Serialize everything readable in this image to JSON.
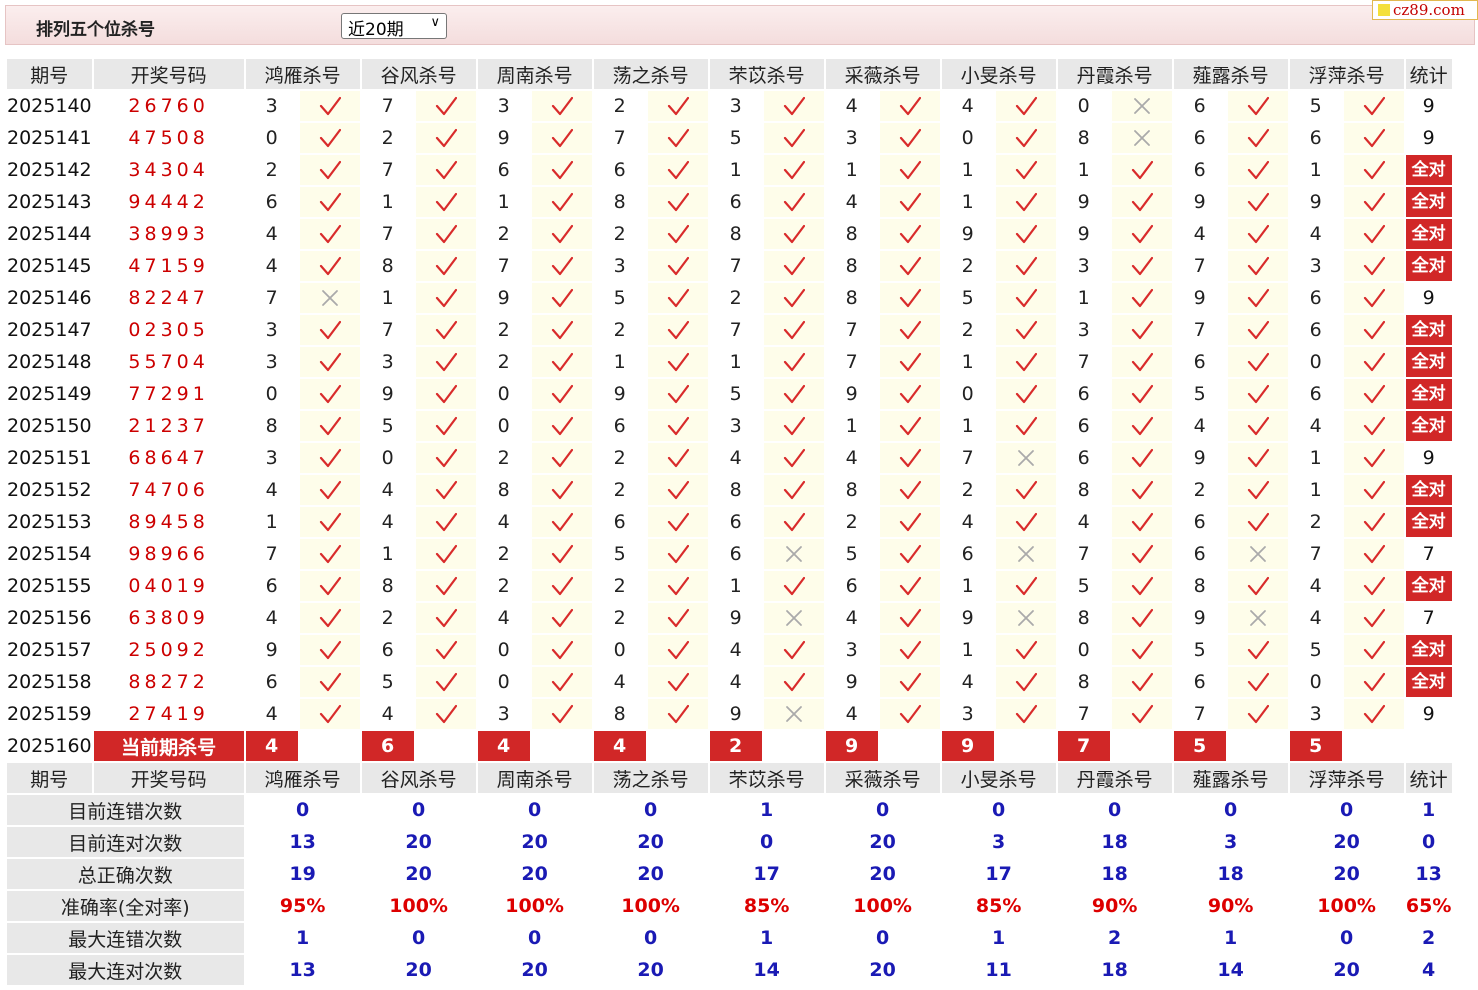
{
  "header": {
    "title": "排列五个位杀号",
    "period_select": {
      "selected": "近20期"
    },
    "logo": "cz89.com"
  },
  "table": {
    "col_period": "期号",
    "col_draw": "开奖号码",
    "col_stat": "统计",
    "experts": [
      "鸿雁杀号",
      "谷风杀号",
      "周南杀号",
      "荡之杀号",
      "芣苡杀号",
      "采薇杀号",
      "小旻杀号",
      "丹霞杀号",
      "薤露杀号",
      "浮萍杀号"
    ],
    "rows": [
      {
        "period": "2025140",
        "draw": "26760",
        "kills": [
          3,
          7,
          3,
          2,
          3,
          4,
          4,
          0,
          6,
          5
        ],
        "hits": [
          1,
          1,
          1,
          1,
          1,
          1,
          1,
          0,
          1,
          1
        ],
        "stat": "9"
      },
      {
        "period": "2025141",
        "draw": "47508",
        "kills": [
          0,
          2,
          9,
          7,
          5,
          3,
          0,
          8,
          6,
          6
        ],
        "hits": [
          1,
          1,
          1,
          1,
          1,
          1,
          1,
          0,
          1,
          1
        ],
        "stat": "9"
      },
      {
        "period": "2025142",
        "draw": "34304",
        "kills": [
          2,
          7,
          6,
          6,
          1,
          1,
          1,
          1,
          6,
          1
        ],
        "hits": [
          1,
          1,
          1,
          1,
          1,
          1,
          1,
          1,
          1,
          1
        ],
        "stat": "全对"
      },
      {
        "period": "2025143",
        "draw": "94442",
        "kills": [
          6,
          1,
          1,
          8,
          6,
          4,
          1,
          9,
          9,
          9
        ],
        "hits": [
          1,
          1,
          1,
          1,
          1,
          1,
          1,
          1,
          1,
          1
        ],
        "stat": "全对"
      },
      {
        "period": "2025144",
        "draw": "38993",
        "kills": [
          4,
          7,
          2,
          2,
          8,
          8,
          9,
          9,
          4,
          4
        ],
        "hits": [
          1,
          1,
          1,
          1,
          1,
          1,
          1,
          1,
          1,
          1
        ],
        "stat": "全对"
      },
      {
        "period": "2025145",
        "draw": "47159",
        "kills": [
          4,
          8,
          7,
          3,
          7,
          8,
          2,
          3,
          7,
          3
        ],
        "hits": [
          1,
          1,
          1,
          1,
          1,
          1,
          1,
          1,
          1,
          1
        ],
        "stat": "全对"
      },
      {
        "period": "2025146",
        "draw": "82247",
        "kills": [
          7,
          1,
          9,
          5,
          2,
          8,
          5,
          1,
          9,
          6
        ],
        "hits": [
          0,
          1,
          1,
          1,
          1,
          1,
          1,
          1,
          1,
          1
        ],
        "stat": "9"
      },
      {
        "period": "2025147",
        "draw": "02305",
        "kills": [
          3,
          7,
          2,
          2,
          7,
          7,
          2,
          3,
          7,
          6
        ],
        "hits": [
          1,
          1,
          1,
          1,
          1,
          1,
          1,
          1,
          1,
          1
        ],
        "stat": "全对"
      },
      {
        "period": "2025148",
        "draw": "55704",
        "kills": [
          3,
          3,
          2,
          1,
          1,
          7,
          1,
          7,
          6,
          0
        ],
        "hits": [
          1,
          1,
          1,
          1,
          1,
          1,
          1,
          1,
          1,
          1
        ],
        "stat": "全对"
      },
      {
        "period": "2025149",
        "draw": "77291",
        "kills": [
          0,
          9,
          0,
          9,
          5,
          9,
          0,
          6,
          5,
          6
        ],
        "hits": [
          1,
          1,
          1,
          1,
          1,
          1,
          1,
          1,
          1,
          1
        ],
        "stat": "全对"
      },
      {
        "period": "2025150",
        "draw": "21237",
        "kills": [
          8,
          5,
          0,
          6,
          3,
          1,
          1,
          6,
          4,
          4
        ],
        "hits": [
          1,
          1,
          1,
          1,
          1,
          1,
          1,
          1,
          1,
          1
        ],
        "stat": "全对"
      },
      {
        "period": "2025151",
        "draw": "68647",
        "kills": [
          3,
          0,
          2,
          2,
          4,
          4,
          7,
          6,
          9,
          1
        ],
        "hits": [
          1,
          1,
          1,
          1,
          1,
          1,
          0,
          1,
          1,
          1
        ],
        "stat": "9"
      },
      {
        "period": "2025152",
        "draw": "74706",
        "kills": [
          4,
          4,
          8,
          2,
          8,
          8,
          2,
          8,
          2,
          1
        ],
        "hits": [
          1,
          1,
          1,
          1,
          1,
          1,
          1,
          1,
          1,
          1
        ],
        "stat": "全对"
      },
      {
        "period": "2025153",
        "draw": "89458",
        "kills": [
          1,
          4,
          4,
          6,
          6,
          2,
          4,
          4,
          6,
          2
        ],
        "hits": [
          1,
          1,
          1,
          1,
          1,
          1,
          1,
          1,
          1,
          1
        ],
        "stat": "全对"
      },
      {
        "period": "2025154",
        "draw": "98966",
        "kills": [
          7,
          1,
          2,
          5,
          6,
          5,
          6,
          7,
          6,
          7
        ],
        "hits": [
          1,
          1,
          1,
          1,
          0,
          1,
          0,
          1,
          0,
          1
        ],
        "stat": "7"
      },
      {
        "period": "2025155",
        "draw": "04019",
        "kills": [
          6,
          8,
          2,
          2,
          1,
          6,
          1,
          5,
          8,
          4
        ],
        "hits": [
          1,
          1,
          1,
          1,
          1,
          1,
          1,
          1,
          1,
          1
        ],
        "stat": "全对"
      },
      {
        "period": "2025156",
        "draw": "63809",
        "kills": [
          4,
          2,
          4,
          2,
          9,
          4,
          9,
          8,
          9,
          4
        ],
        "hits": [
          1,
          1,
          1,
          1,
          0,
          1,
          0,
          1,
          0,
          1
        ],
        "stat": "7"
      },
      {
        "period": "2025157",
        "draw": "25092",
        "kills": [
          9,
          6,
          0,
          0,
          4,
          3,
          1,
          0,
          5,
          5
        ],
        "hits": [
          1,
          1,
          1,
          1,
          1,
          1,
          1,
          1,
          1,
          1
        ],
        "stat": "全对"
      },
      {
        "period": "2025158",
        "draw": "88272",
        "kills": [
          6,
          5,
          0,
          4,
          4,
          9,
          4,
          8,
          6,
          0
        ],
        "hits": [
          1,
          1,
          1,
          1,
          1,
          1,
          1,
          1,
          1,
          1
        ],
        "stat": "全对"
      },
      {
        "period": "2025159",
        "draw": "27419",
        "kills": [
          4,
          4,
          3,
          8,
          9,
          4,
          3,
          7,
          7,
          3
        ],
        "hits": [
          1,
          1,
          1,
          1,
          0,
          1,
          1,
          1,
          1,
          1
        ],
        "stat": "9"
      }
    ],
    "current": {
      "period": "2025160",
      "label": "当前期杀号",
      "kills": [
        4,
        6,
        4,
        4,
        2,
        9,
        9,
        7,
        5,
        5
      ]
    },
    "summary": [
      {
        "label": "目前连错次数",
        "values": [
          "0",
          "0",
          "0",
          "0",
          "1",
          "0",
          "0",
          "0",
          "0",
          "0"
        ],
        "stat": "1",
        "red": false
      },
      {
        "label": "目前连对次数",
        "values": [
          "13",
          "20",
          "20",
          "20",
          "0",
          "20",
          "3",
          "18",
          "3",
          "20"
        ],
        "stat": "0",
        "red": false
      },
      {
        "label": "总正确次数",
        "values": [
          "19",
          "20",
          "20",
          "20",
          "17",
          "20",
          "17",
          "18",
          "18",
          "20"
        ],
        "stat": "13",
        "red": false
      },
      {
        "label": "准确率(全对率)",
        "values": [
          "95%",
          "100%",
          "100%",
          "100%",
          "85%",
          "100%",
          "85%",
          "90%",
          "90%",
          "100%"
        ],
        "stat": "65%",
        "red": true
      },
      {
        "label": "最大连错次数",
        "values": [
          "1",
          "0",
          "0",
          "0",
          "1",
          "0",
          "1",
          "2",
          "1",
          "0"
        ],
        "stat": "2",
        "red": false
      },
      {
        "label": "最大连对次数",
        "values": [
          "13",
          "20",
          "20",
          "20",
          "14",
          "20",
          "11",
          "18",
          "14",
          "20"
        ],
        "stat": "4",
        "red": false
      }
    ]
  },
  "colors": {
    "accent_red": "#d12727",
    "tick_red": "#d92b2b",
    "cross_gray": "#aaaaaa",
    "stat_blue": "#1a1ab4",
    "mark_bg": "#fefdea"
  },
  "icons": {
    "hit": "check-icon",
    "miss": "cross-icon"
  }
}
